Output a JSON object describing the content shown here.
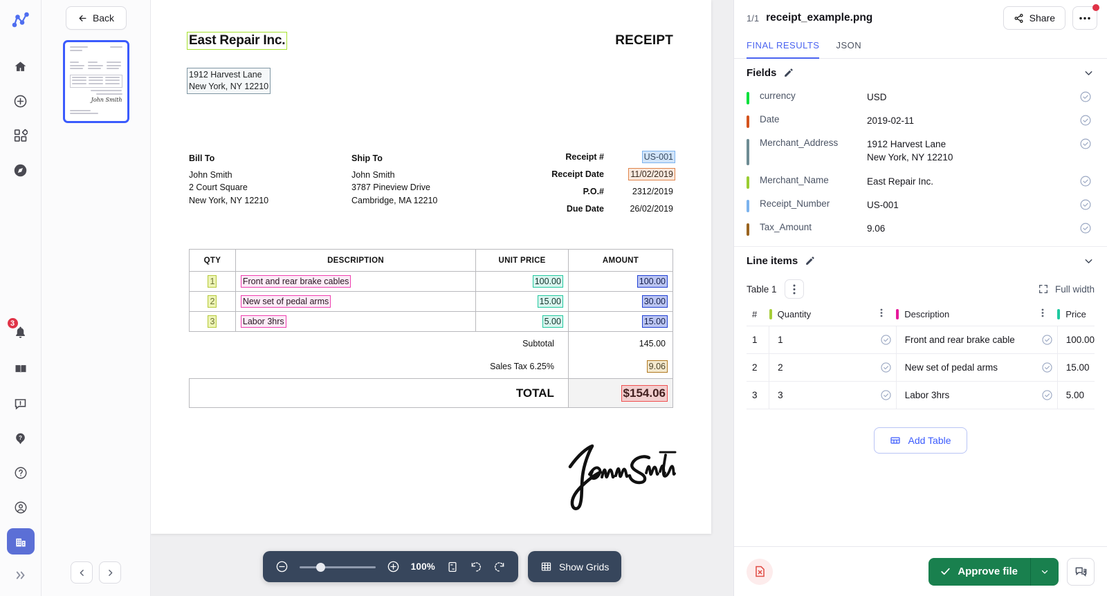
{
  "rail": {
    "logo": "node-graph-logo",
    "items": [
      {
        "name": "home-icon"
      },
      {
        "name": "add-circle-icon"
      },
      {
        "name": "apps-grid-icon"
      },
      {
        "name": "compass-icon"
      }
    ],
    "bottom_items": [
      {
        "name": "bell-icon",
        "badge": "3"
      },
      {
        "name": "book-icon"
      },
      {
        "name": "feedback-icon"
      },
      {
        "name": "help-filled-icon"
      },
      {
        "name": "help-circle-icon"
      },
      {
        "name": "account-icon"
      },
      {
        "name": "organization-icon",
        "active": true
      },
      {
        "name": "expand-rail-icon"
      }
    ]
  },
  "thumbnails": {
    "back_label": "Back",
    "prev_label": "‹",
    "next_label": "›",
    "signature_text": "John Smith"
  },
  "toolbar": {
    "zoom_out": "zoom-out-icon",
    "zoom_in": "zoom-in-icon",
    "zoom_level": "100%",
    "fit_page": "fit-page-icon",
    "rotate_left": "rotate-left-icon",
    "rotate_right": "rotate-right-icon",
    "show_grids_label": "Show Grids"
  },
  "document": {
    "merchant_name": "East Repair Inc.",
    "receipt_word": "RECEIPT",
    "address_line1": "1912 Harvest Lane",
    "address_line2": "New York, NY 12210",
    "bill_to_label": "Bill To",
    "bill_to": [
      "John Smith",
      "2 Court Square",
      "New York, NY 12210"
    ],
    "ship_to_label": "Ship To",
    "ship_to": [
      "John Smith",
      "3787 Pineview Drive",
      "Cambridge, MA 12210"
    ],
    "meta": [
      {
        "label": "Receipt #",
        "value": "US-001"
      },
      {
        "label": "Receipt Date",
        "value": "11/02/2019"
      },
      {
        "label": "P.O.#",
        "value": "2312/2019"
      },
      {
        "label": "Due Date",
        "value": "26/02/2019"
      }
    ],
    "table_headers": [
      "QTY",
      "DESCRIPTION",
      "UNIT PRICE",
      "AMOUNT"
    ],
    "rows": [
      {
        "qty": "1",
        "description": "Front and rear brake cables",
        "unit_price": "100.00",
        "amount": "100.00"
      },
      {
        "qty": "2",
        "description": "New set of pedal arms",
        "unit_price": "15.00",
        "amount": "30.00"
      },
      {
        "qty": "3",
        "description": "Labor 3hrs",
        "unit_price": "5.00",
        "amount": "15.00"
      }
    ],
    "subtotal_label": "Subtotal",
    "subtotal_value": "145.00",
    "tax_label": "Sales Tax 6.25%",
    "tax_value": "9.06",
    "total_label": "TOTAL",
    "total_value": "$154.06",
    "signature": "John Smith",
    "annotation_colors": {
      "merchant_name": "#a6e22e",
      "address": "#7f96a3",
      "receipt_number": "#7cb3ee",
      "receipt_date": "#e0844a",
      "qty": "#b6c93a",
      "description": "#ef3fb0",
      "unit_price": "#23c9a0",
      "amount": "#1f3fd4",
      "tax": "#b07820",
      "total": "#f05050"
    }
  },
  "panel": {
    "page_number": "1/1",
    "file_name": "receipt_example.png",
    "share_label": "Share",
    "more_label": "•••",
    "tabs": [
      {
        "label": "FINAL RESULTS",
        "active": true
      },
      {
        "label": "JSON",
        "active": false
      }
    ],
    "fields_section_title": "Fields",
    "fields": [
      {
        "name": "currency",
        "value": "USD",
        "color": "#00e03c",
        "verified": true
      },
      {
        "name": "Date",
        "value": "2019-02-11",
        "color": "#d4541e",
        "verified": true
      },
      {
        "name": "Merchant_Address",
        "value": "1912 Harvest Lane\nNew York, NY 12210",
        "color": "#6e8c94",
        "verified": true
      },
      {
        "name": "Merchant_Name",
        "value": "East Repair Inc.",
        "color": "#9acd32",
        "verified": true
      },
      {
        "name": "Receipt_Number",
        "value": "US-001",
        "color": "#7cb3ee",
        "verified": true
      },
      {
        "name": "Tax_Amount",
        "value": "9.06",
        "color": "#9a6420",
        "verified": true
      }
    ],
    "line_items_section_title": "Line items",
    "table_name": "Table 1",
    "full_width_label": "Full width",
    "columns": [
      {
        "label": "#",
        "color": null
      },
      {
        "label": "Quantity",
        "color": "#a6ce39"
      },
      {
        "label": "Description",
        "color": "#e6199b"
      },
      {
        "label": "Price",
        "color": "#1fc9a0"
      }
    ],
    "line_items": [
      {
        "index": "1",
        "quantity": "1",
        "description": "Front and rear brake cable",
        "price": "100.00"
      },
      {
        "index": "2",
        "quantity": "2",
        "description": "New set of pedal arms",
        "price": "15.00"
      },
      {
        "index": "3",
        "quantity": "3",
        "description": "Labor 3hrs",
        "price": "5.00"
      }
    ],
    "add_table_label": "Add Table",
    "approve_label": "Approve file",
    "reject_icon": "reject-file-icon",
    "chat_icon": "chat-icon"
  }
}
